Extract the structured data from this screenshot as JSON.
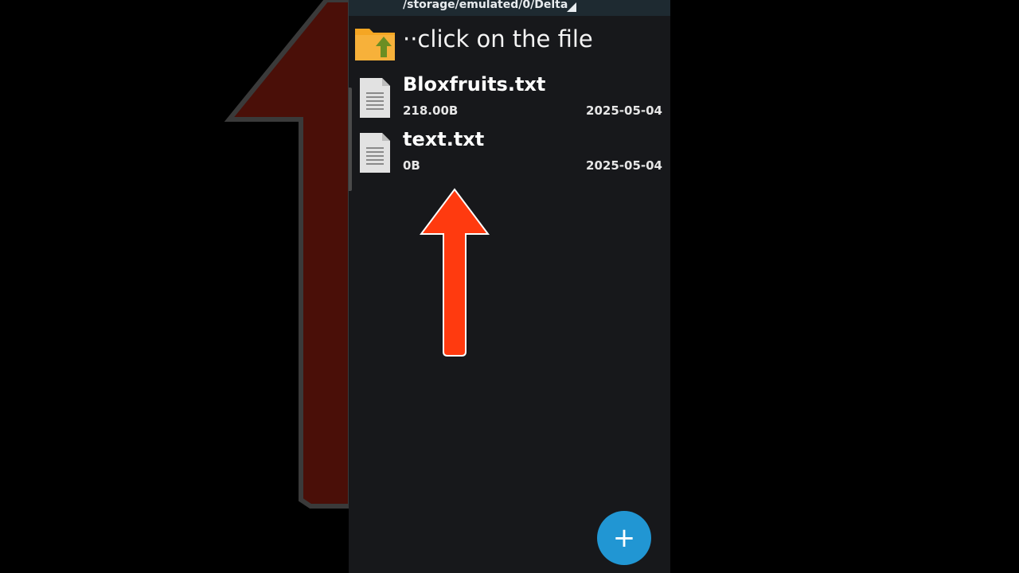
{
  "path_bar": {
    "path": "/storage/emulated/0/Delta",
    "dropdown_icon": "triangle-down-right-icon"
  },
  "parent_dir": {
    "icon": "folder-up-icon",
    "label": "··click on the file"
  },
  "files": [
    {
      "name": "Bloxfruits.txt",
      "size": "218.00B",
      "date": "2025-05-04",
      "icon": "text-file-icon"
    },
    {
      "name": "text.txt",
      "size": "0B",
      "date": "2025-05-04",
      "icon": "text-file-icon"
    }
  ],
  "fab": {
    "label": "+",
    "icon": "plus-icon",
    "color": "#2196d3"
  },
  "overlay_arrow": {
    "icon": "arrow-up-icon",
    "color": "#ff3a0f"
  },
  "colors": {
    "screen_bg": "#17181b",
    "path_bar_bg": "#1e2a31",
    "folder": "#f5a623",
    "folder_arrow": "#6b8e23"
  }
}
